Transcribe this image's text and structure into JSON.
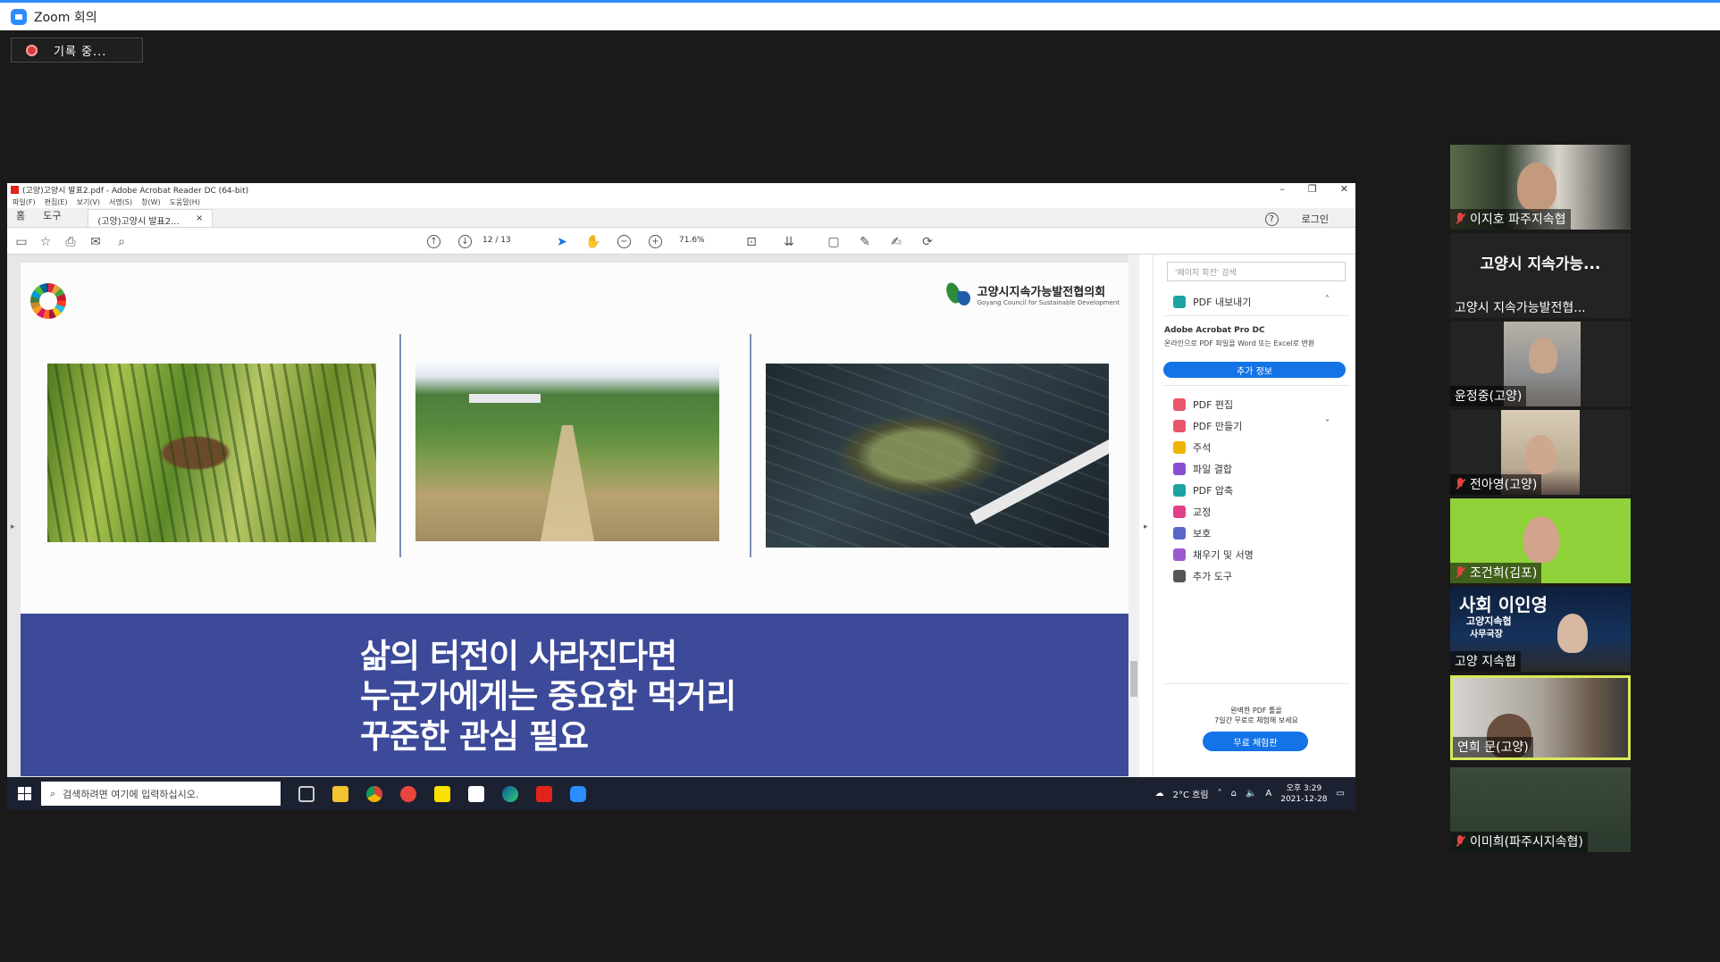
{
  "zoom": {
    "window_title": "Zoom 회의",
    "recording_label": "기록 중..."
  },
  "acrobat": {
    "title": "(고양)고양시 발표2.pdf - Adobe Acrobat Reader DC (64-bit)",
    "menu": [
      "파일(F)",
      "편집(E)",
      "보기(V)",
      "서명(S)",
      "창(W)",
      "도움말(H)"
    ],
    "tabs": {
      "home": "홈",
      "tools": "도구",
      "document": "(고양)고양시 발표2...",
      "close": "×"
    },
    "login": "로그인",
    "help": "?",
    "page_current": "12",
    "page_total": "/ 13",
    "zoom_level": "71.6%"
  },
  "slide": {
    "council_name_ko": "고양시지속가능발전협의회",
    "council_name_en": "Goyang Council for Sustainable Development",
    "headline": [
      "삶의 터전이 사라진다면",
      "누군가에게는 중요한 먹거리",
      "꾸준한 관심 필요"
    ]
  },
  "right_panel": {
    "search_placeholder": "'페이지 회전' 검색",
    "export_pdf": "PDF 내보내기",
    "pro_title": "Adobe Acrobat Pro DC",
    "pro_desc": "온라인으로 PDF 파일을 Word 또는 Excel로 변환",
    "more_info": "추가 정보",
    "tools": [
      "PDF 편집",
      "PDF 만들기",
      "주석",
      "파일 결합",
      "PDF 압축",
      "교정",
      "보호",
      "채우기 및 서명",
      "추가 도구"
    ],
    "tool_colors": [
      "#e8566b",
      "#e8566b",
      "#f0b400",
      "#8a4fd1",
      "#1ea3a3",
      "#e0408a",
      "#5965c7",
      "#9b59d0",
      "#555555"
    ],
    "trial_text": [
      "완벽한 PDF 툴을",
      "7일간 무료로 체험해 보세요"
    ],
    "trial_button": "무료 체험판"
  },
  "taskbar": {
    "search_placeholder": "검색하려면 여기에 입력하십시오.",
    "weather": "2°C 흐림",
    "ime": "A",
    "time": "오후 3:29",
    "date": "2021-12-28"
  },
  "participants": [
    {
      "name": "이지호 파주지속협",
      "muted": true
    },
    {
      "name": "고양시 지속가능발전협...",
      "big_label": "고양시 지속가능...",
      "muted": false
    },
    {
      "name": "윤정중(고양)",
      "muted": false
    },
    {
      "name": "전아영(고양)",
      "muted": true
    },
    {
      "name": "조건희(김포)",
      "muted": true
    },
    {
      "name": "고양 지속협",
      "overlay_title": "사회 이인영",
      "overlay_sub1": "고양지속협",
      "overlay_sub2": "사무국장",
      "muted": false
    },
    {
      "name": "연희 문(고양)",
      "muted": false,
      "active_speaker": true
    },
    {
      "name": "이미희(파주시지속협)",
      "muted": true
    }
  ]
}
